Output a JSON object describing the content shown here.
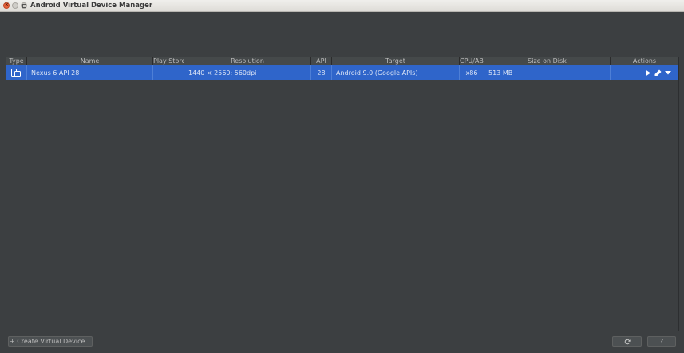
{
  "window": {
    "title": "Android Virtual Device Manager"
  },
  "table": {
    "columns": [
      "Type",
      "Name",
      "Play Store",
      "Resolution",
      "API",
      "Target",
      "CPU/ABI",
      "Size on Disk",
      "Actions"
    ],
    "rows": [
      {
        "type_icon": "phone-tablet-icon",
        "name": "Nexus 6 API 28",
        "play_store": "",
        "resolution": "1440 × 2560: 560dpi",
        "api": "28",
        "target": "Android 9.0 (Google APIs)",
        "cpu_abi": "x86",
        "size_on_disk": "513 MB",
        "actions": [
          "play-icon",
          "edit-pencil-icon",
          "dropdown-arrow-icon"
        ]
      }
    ]
  },
  "footer": {
    "create_label": "+ Create Virtual Device...",
    "refresh_icon": "refresh-icon",
    "help_label": "?"
  },
  "colors": {
    "background": "#3c3f41",
    "selection": "#2f65ca",
    "header": "#45494a"
  }
}
